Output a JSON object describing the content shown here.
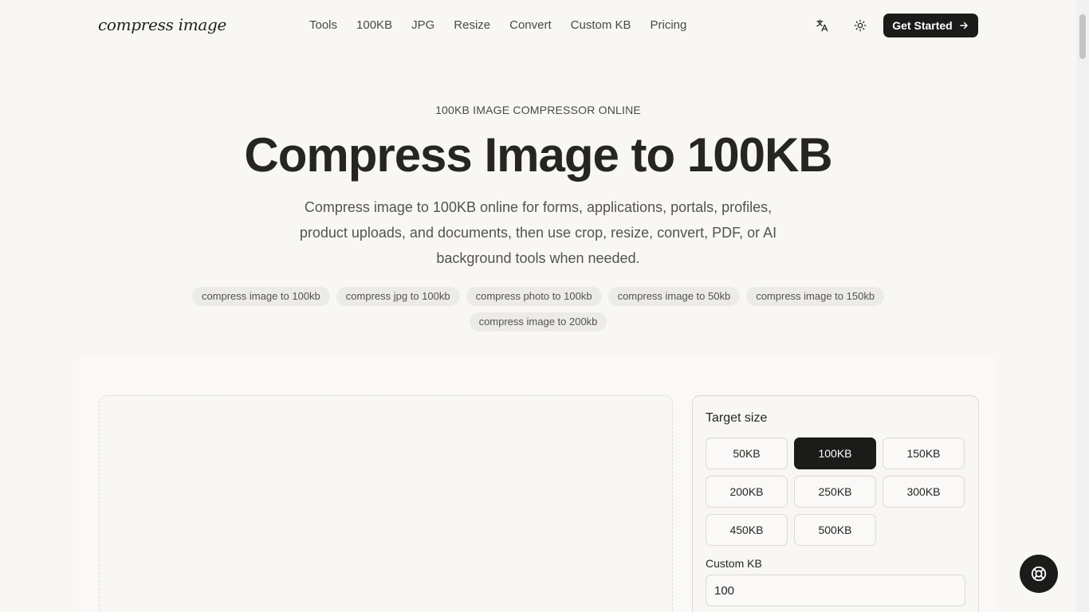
{
  "header": {
    "logo": "compress image",
    "nav": [
      "Tools",
      "100KB",
      "JPG",
      "Resize",
      "Convert",
      "Custom KB",
      "Pricing"
    ],
    "cta_label": "Get Started"
  },
  "hero": {
    "eyebrow": "100KB IMAGE COMPRESSOR ONLINE",
    "title": "Compress Image to 100KB",
    "subtitle": "Compress image to 100KB online for forms, applications, portals, profiles, product uploads, and documents, then use crop, resize, convert, PDF, or AI background tools when needed.",
    "chips": [
      "compress image to 100kb",
      "compress jpg to 100kb",
      "compress photo to 100kb",
      "compress image to 50kb",
      "compress image to 150kb",
      "compress image to 200kb"
    ]
  },
  "panel": {
    "title": "Target size",
    "sizes": [
      "50KB",
      "100KB",
      "150KB",
      "200KB",
      "250KB",
      "300KB",
      "450KB",
      "500KB"
    ],
    "selected": "100KB",
    "custom_label": "Custom KB",
    "custom_value": "100"
  },
  "icons": {
    "translate": "translate-icon",
    "theme": "sun-icon",
    "cta_arrow": "arrow-right-icon",
    "help": "lifebuoy-icon"
  },
  "colors": {
    "background": "#f8f7f4",
    "primary": "#1b1b19",
    "border": "#dcdad4"
  }
}
